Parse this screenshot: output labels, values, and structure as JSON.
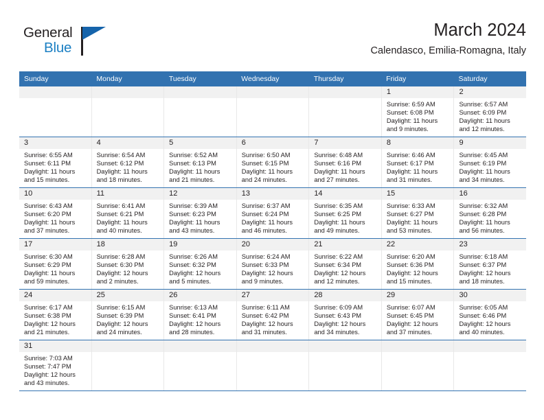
{
  "brand": {
    "name_part1": "General",
    "name_part2": "Blue",
    "flag_color": "#1664ab",
    "blue_color": "#1b7fc3",
    "dark_color": "#231f20",
    "logo_icon": "flag-icon"
  },
  "header": {
    "title": "March 2024",
    "subtitle": "Calendasco, Emilia-Romagna, Italy",
    "accent_color": "#3272b0"
  },
  "calendar": {
    "weekdays": [
      "Sunday",
      "Monday",
      "Tuesday",
      "Wednesday",
      "Thursday",
      "Friday",
      "Saturday"
    ],
    "labels": {
      "sunrise_prefix": "Sunrise:",
      "sunset_prefix": "Sunset:",
      "daylight_prefix": "Daylight:"
    },
    "weeks": [
      [
        {
          "day": "",
          "empty": true
        },
        {
          "day": "",
          "empty": true
        },
        {
          "day": "",
          "empty": true
        },
        {
          "day": "",
          "empty": true
        },
        {
          "day": "",
          "empty": true
        },
        {
          "day": "1",
          "sunrise": "Sunrise: 6:59 AM",
          "sunset": "Sunset: 6:08 PM",
          "daylight_l1": "Daylight: 11 hours",
          "daylight_l2": "and 9 minutes."
        },
        {
          "day": "2",
          "sunrise": "Sunrise: 6:57 AM",
          "sunset": "Sunset: 6:09 PM",
          "daylight_l1": "Daylight: 11 hours",
          "daylight_l2": "and 12 minutes."
        }
      ],
      [
        {
          "day": "3",
          "sunrise": "Sunrise: 6:55 AM",
          "sunset": "Sunset: 6:11 PM",
          "daylight_l1": "Daylight: 11 hours",
          "daylight_l2": "and 15 minutes."
        },
        {
          "day": "4",
          "sunrise": "Sunrise: 6:54 AM",
          "sunset": "Sunset: 6:12 PM",
          "daylight_l1": "Daylight: 11 hours",
          "daylight_l2": "and 18 minutes."
        },
        {
          "day": "5",
          "sunrise": "Sunrise: 6:52 AM",
          "sunset": "Sunset: 6:13 PM",
          "daylight_l1": "Daylight: 11 hours",
          "daylight_l2": "and 21 minutes."
        },
        {
          "day": "6",
          "sunrise": "Sunrise: 6:50 AM",
          "sunset": "Sunset: 6:15 PM",
          "daylight_l1": "Daylight: 11 hours",
          "daylight_l2": "and 24 minutes."
        },
        {
          "day": "7",
          "sunrise": "Sunrise: 6:48 AM",
          "sunset": "Sunset: 6:16 PM",
          "daylight_l1": "Daylight: 11 hours",
          "daylight_l2": "and 27 minutes."
        },
        {
          "day": "8",
          "sunrise": "Sunrise: 6:46 AM",
          "sunset": "Sunset: 6:17 PM",
          "daylight_l1": "Daylight: 11 hours",
          "daylight_l2": "and 31 minutes."
        },
        {
          "day": "9",
          "sunrise": "Sunrise: 6:45 AM",
          "sunset": "Sunset: 6:19 PM",
          "daylight_l1": "Daylight: 11 hours",
          "daylight_l2": "and 34 minutes."
        }
      ],
      [
        {
          "day": "10",
          "sunrise": "Sunrise: 6:43 AM",
          "sunset": "Sunset: 6:20 PM",
          "daylight_l1": "Daylight: 11 hours",
          "daylight_l2": "and 37 minutes."
        },
        {
          "day": "11",
          "sunrise": "Sunrise: 6:41 AM",
          "sunset": "Sunset: 6:21 PM",
          "daylight_l1": "Daylight: 11 hours",
          "daylight_l2": "and 40 minutes."
        },
        {
          "day": "12",
          "sunrise": "Sunrise: 6:39 AM",
          "sunset": "Sunset: 6:23 PM",
          "daylight_l1": "Daylight: 11 hours",
          "daylight_l2": "and 43 minutes."
        },
        {
          "day": "13",
          "sunrise": "Sunrise: 6:37 AM",
          "sunset": "Sunset: 6:24 PM",
          "daylight_l1": "Daylight: 11 hours",
          "daylight_l2": "and 46 minutes."
        },
        {
          "day": "14",
          "sunrise": "Sunrise: 6:35 AM",
          "sunset": "Sunset: 6:25 PM",
          "daylight_l1": "Daylight: 11 hours",
          "daylight_l2": "and 49 minutes."
        },
        {
          "day": "15",
          "sunrise": "Sunrise: 6:33 AM",
          "sunset": "Sunset: 6:27 PM",
          "daylight_l1": "Daylight: 11 hours",
          "daylight_l2": "and 53 minutes."
        },
        {
          "day": "16",
          "sunrise": "Sunrise: 6:32 AM",
          "sunset": "Sunset: 6:28 PM",
          "daylight_l1": "Daylight: 11 hours",
          "daylight_l2": "and 56 minutes."
        }
      ],
      [
        {
          "day": "17",
          "sunrise": "Sunrise: 6:30 AM",
          "sunset": "Sunset: 6:29 PM",
          "daylight_l1": "Daylight: 11 hours",
          "daylight_l2": "and 59 minutes."
        },
        {
          "day": "18",
          "sunrise": "Sunrise: 6:28 AM",
          "sunset": "Sunset: 6:30 PM",
          "daylight_l1": "Daylight: 12 hours",
          "daylight_l2": "and 2 minutes."
        },
        {
          "day": "19",
          "sunrise": "Sunrise: 6:26 AM",
          "sunset": "Sunset: 6:32 PM",
          "daylight_l1": "Daylight: 12 hours",
          "daylight_l2": "and 5 minutes."
        },
        {
          "day": "20",
          "sunrise": "Sunrise: 6:24 AM",
          "sunset": "Sunset: 6:33 PM",
          "daylight_l1": "Daylight: 12 hours",
          "daylight_l2": "and 9 minutes."
        },
        {
          "day": "21",
          "sunrise": "Sunrise: 6:22 AM",
          "sunset": "Sunset: 6:34 PM",
          "daylight_l1": "Daylight: 12 hours",
          "daylight_l2": "and 12 minutes."
        },
        {
          "day": "22",
          "sunrise": "Sunrise: 6:20 AM",
          "sunset": "Sunset: 6:36 PM",
          "daylight_l1": "Daylight: 12 hours",
          "daylight_l2": "and 15 minutes."
        },
        {
          "day": "23",
          "sunrise": "Sunrise: 6:18 AM",
          "sunset": "Sunset: 6:37 PM",
          "daylight_l1": "Daylight: 12 hours",
          "daylight_l2": "and 18 minutes."
        }
      ],
      [
        {
          "day": "24",
          "sunrise": "Sunrise: 6:17 AM",
          "sunset": "Sunset: 6:38 PM",
          "daylight_l1": "Daylight: 12 hours",
          "daylight_l2": "and 21 minutes."
        },
        {
          "day": "25",
          "sunrise": "Sunrise: 6:15 AM",
          "sunset": "Sunset: 6:39 PM",
          "daylight_l1": "Daylight: 12 hours",
          "daylight_l2": "and 24 minutes."
        },
        {
          "day": "26",
          "sunrise": "Sunrise: 6:13 AM",
          "sunset": "Sunset: 6:41 PM",
          "daylight_l1": "Daylight: 12 hours",
          "daylight_l2": "and 28 minutes."
        },
        {
          "day": "27",
          "sunrise": "Sunrise: 6:11 AM",
          "sunset": "Sunset: 6:42 PM",
          "daylight_l1": "Daylight: 12 hours",
          "daylight_l2": "and 31 minutes."
        },
        {
          "day": "28",
          "sunrise": "Sunrise: 6:09 AM",
          "sunset": "Sunset: 6:43 PM",
          "daylight_l1": "Daylight: 12 hours",
          "daylight_l2": "and 34 minutes."
        },
        {
          "day": "29",
          "sunrise": "Sunrise: 6:07 AM",
          "sunset": "Sunset: 6:45 PM",
          "daylight_l1": "Daylight: 12 hours",
          "daylight_l2": "and 37 minutes."
        },
        {
          "day": "30",
          "sunrise": "Sunrise: 6:05 AM",
          "sunset": "Sunset: 6:46 PM",
          "daylight_l1": "Daylight: 12 hours",
          "daylight_l2": "and 40 minutes."
        }
      ],
      [
        {
          "day": "31",
          "sunrise": "Sunrise: 7:03 AM",
          "sunset": "Sunset: 7:47 PM",
          "daylight_l1": "Daylight: 12 hours",
          "daylight_l2": "and 43 minutes."
        },
        {
          "day": "",
          "empty": true
        },
        {
          "day": "",
          "empty": true
        },
        {
          "day": "",
          "empty": true
        },
        {
          "day": "",
          "empty": true
        },
        {
          "day": "",
          "empty": true
        },
        {
          "day": "",
          "empty": true
        }
      ]
    ]
  }
}
